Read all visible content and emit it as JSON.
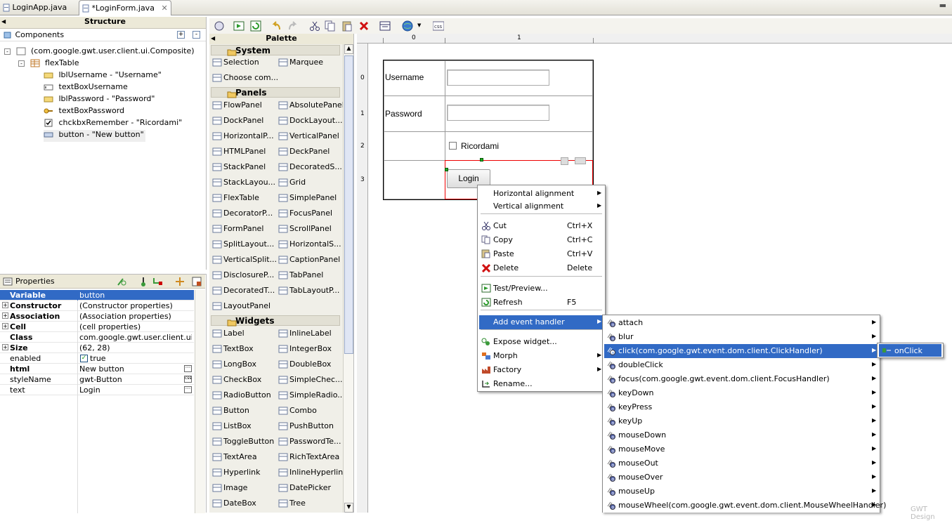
{
  "tabs": [
    {
      "label": "LoginApp.java",
      "active": false
    },
    {
      "label": "*LoginForm.java",
      "active": true
    }
  ],
  "structure": {
    "title": "Structure",
    "components_label": "Components",
    "tree": [
      {
        "label": "(com.google.gwt.user.client.ui.Composite)"
      },
      {
        "label": "flexTable"
      },
      {
        "label": "lblUsername - \"Username\""
      },
      {
        "label": "textBoxUsername"
      },
      {
        "label": "lblPassword - \"Password\""
      },
      {
        "label": "textBoxPassword"
      },
      {
        "label": "chckbxRemember - \"Ricordami\""
      },
      {
        "label": "button - \"New button\""
      }
    ]
  },
  "properties": {
    "title": "Properties",
    "rows": [
      {
        "key": "Variable",
        "value": "button"
      },
      {
        "key": "Constructor",
        "value": "(Constructor properties)"
      },
      {
        "key": "Association",
        "value": "(Association properties)"
      },
      {
        "key": "Cell",
        "value": "(cell properties)"
      },
      {
        "key": "Class",
        "value": "com.google.gwt.user.client.ui...."
      },
      {
        "key": "Size",
        "value": "(62, 28)"
      },
      {
        "key": "enabled",
        "value": "true"
      },
      {
        "key": "html",
        "value": "New button"
      },
      {
        "key": "styleName",
        "value": "gwt-Button"
      },
      {
        "key": "text",
        "value": "Login"
      }
    ]
  },
  "palette": {
    "title": "Palette",
    "system_label": "System",
    "system": [
      "Selection",
      "Marquee",
      "Choose com..."
    ],
    "panels_label": "Panels",
    "panels": [
      "FlowPanel",
      "AbsolutePanel",
      "DockPanel",
      "DockLayout...",
      "HorizontalP...",
      "VerticalPanel",
      "HTMLPanel",
      "DeckPanel",
      "StackPanel",
      "DecoratedS...",
      "StackLayou...",
      "Grid",
      "FlexTable",
      "SimplePanel",
      "DecoratorP...",
      "FocusPanel",
      "FormPanel",
      "ScrollPanel",
      "SplitLayout...",
      "HorizontalS...",
      "VerticalSplit...",
      "CaptionPanel",
      "DisclosureP...",
      "TabPanel",
      "DecoratedT...",
      "TabLayoutP...",
      "LayoutPanel"
    ],
    "widgets_label": "Widgets",
    "widgets": [
      "Label",
      "InlineLabel",
      "TextBox",
      "IntegerBox",
      "LongBox",
      "DoubleBox",
      "CheckBox",
      "SimpleChec...",
      "RadioButton",
      "SimpleRadio...",
      "Button",
      "Combo",
      "ListBox",
      "PushButton",
      "ToggleButton",
      "PasswordTe...",
      "TextArea",
      "RichTextArea",
      "Hyperlink",
      "InlineHyperlink",
      "Image",
      "DatePicker",
      "DateBox",
      "Tree"
    ]
  },
  "canvas": {
    "col_labels": [
      "0",
      "1"
    ],
    "row_labels": [
      "0",
      "1",
      "2",
      "3"
    ],
    "username_label": "Username",
    "password_label": "Password",
    "checkbox_label": "Ricordami",
    "button_label": "Login",
    "watermark": "GWT Design"
  },
  "context_menu": {
    "items": [
      {
        "label": "Horizontal alignment",
        "submenu": true
      },
      {
        "label": "Vertical alignment",
        "submenu": true
      },
      {
        "label": "Cut",
        "shortcut": "Ctrl+X"
      },
      {
        "label": "Copy",
        "shortcut": "Ctrl+C"
      },
      {
        "label": "Paste",
        "shortcut": "Ctrl+V"
      },
      {
        "label": "Delete",
        "shortcut": "Delete"
      },
      {
        "label": "Test/Preview..."
      },
      {
        "label": "Refresh",
        "shortcut": "F5"
      },
      {
        "label": "Add event handler",
        "submenu": true,
        "selected": true
      },
      {
        "label": "Expose widget..."
      },
      {
        "label": "Morph",
        "submenu": true
      },
      {
        "label": "Factory",
        "submenu": true
      },
      {
        "label": "Rename..."
      }
    ]
  },
  "event_menu": {
    "items": [
      "attach",
      "blur",
      "click(com.google.gwt.event.dom.client.ClickHandler)",
      "doubleClick",
      "focus(com.google.gwt.event.dom.client.FocusHandler)",
      "keyDown",
      "keyPress",
      "keyUp",
      "mouseDown",
      "mouseMove",
      "mouseOut",
      "mouseOver",
      "mouseUp",
      "mouseWheel(com.google.gwt.event.dom.client.MouseWheelHandler)"
    ],
    "selected": "click(com.google.gwt.event.dom.client.ClickHandler)"
  },
  "click_submenu": {
    "item": "onClick"
  },
  "colors": {
    "selection": "#316ac5",
    "panel_bg": "#ece9d8"
  }
}
